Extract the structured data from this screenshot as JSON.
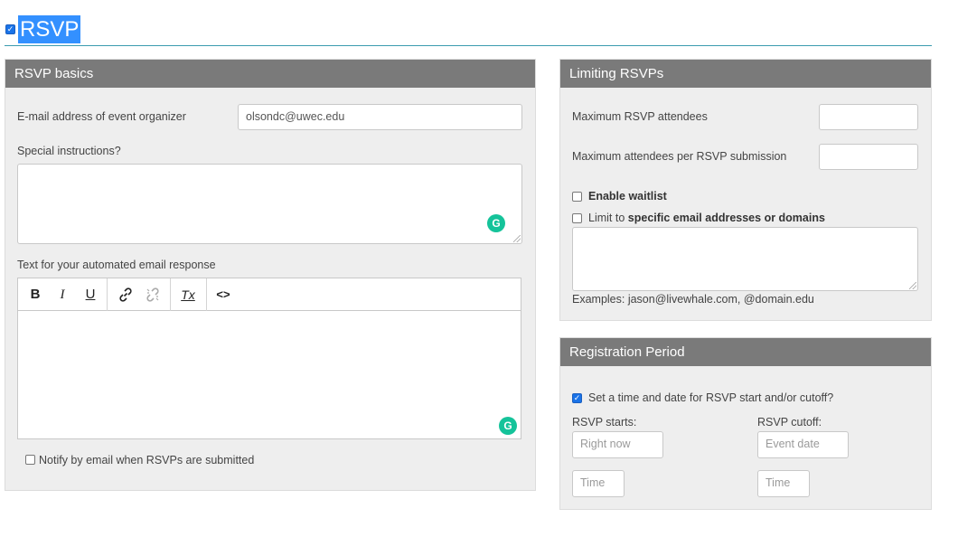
{
  "header": {
    "title": "RSVP",
    "enabled_check": "✓"
  },
  "basics": {
    "title": "RSVP basics",
    "organizer_label": "E-mail address of event organizer",
    "organizer_value": "olsondc@uwec.edu",
    "instructions_label": "Special instructions?",
    "autoresponse_label": "Text for your automated email response",
    "toolbar": {
      "bold": "B",
      "italic": "I",
      "underline": "U",
      "clear_format": "Tx",
      "source": "<>"
    },
    "notify_label": "Notify by email when RSVPs are submitted",
    "grammarly_glyph": "G"
  },
  "limiting": {
    "title": "Limiting RSVPs",
    "max_attendees_label": "Maximum RSVP attendees",
    "max_attendees_value": "",
    "max_per_submission_label": "Maximum attendees per RSVP submission",
    "max_per_submission_value": "",
    "waitlist_label": "Enable waitlist",
    "limit_prefix": "Limit to",
    "limit_bold": "specific email addresses or domains",
    "examples": "Examples: jason@livewhale.com, @domain.edu"
  },
  "registration": {
    "title": "Registration Period",
    "set_time_label": "Set a time and date for RSVP start and/or cutoff?",
    "set_time_checked": "✓",
    "starts_label": "RSVP starts:",
    "starts_date_placeholder": "Right now",
    "starts_time_placeholder": "Time",
    "cutoff_label": "RSVP cutoff:",
    "cutoff_date_placeholder": "Event date",
    "cutoff_time_placeholder": "Time"
  },
  "colors": {
    "panel_header": "#7a7a7a",
    "panel_bg": "#eeeeee",
    "accent": "#3390ff",
    "grammarly": "#15c39a",
    "rule": "#3b9cb0"
  }
}
